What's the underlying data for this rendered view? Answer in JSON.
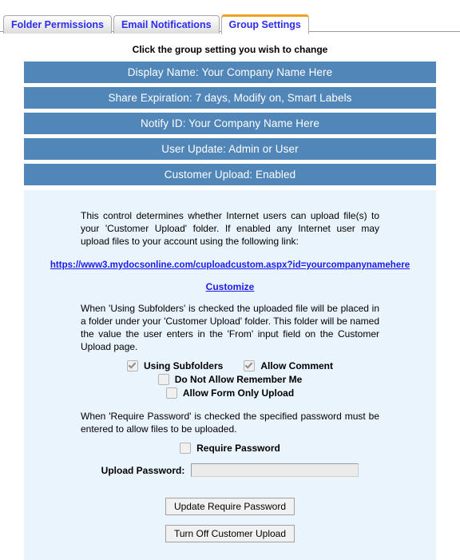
{
  "tabs": [
    {
      "label": "Folder Permissions",
      "active": false
    },
    {
      "label": "Email Notifications",
      "active": false
    },
    {
      "label": "Group Settings",
      "active": true
    }
  ],
  "instruction": "Click the group setting you wish to change",
  "setting_bars": [
    "Display Name:  Your Company Name Here",
    "Share Expiration: 7 days, Modify on, Smart Labels",
    "Notify ID:  Your Company Name Here",
    "User Update:  Admin or User",
    "Customer Upload:  Enabled"
  ],
  "panel": {
    "paragraph_1": "This control determines whether Internet users can upload file(s) to your 'Customer Upload' folder. If enabled any Internet user may upload files to your account using the following link:",
    "upload_link": "https://www3.mydocsonline.com/cuploadcustom.aspx?id=yourcompanynamehere",
    "customize_link": "Customize",
    "paragraph_2": "When 'Using Subfolders' is checked the uploaded file will be placed in a folder under your 'Customer Upload' folder. This folder will be named the value the user enters in the 'From' input field on the Customer Upload page.",
    "checkboxes": [
      {
        "label": "Using Subfolders",
        "checked": true
      },
      {
        "label": "Allow Comment",
        "checked": true
      },
      {
        "label": "Do Not Allow Remember Me",
        "checked": false
      },
      {
        "label": "Allow Form Only Upload",
        "checked": false
      }
    ],
    "paragraph_3": "When 'Require Password' is checked the specified password must be entered to allow files to be uploaded.",
    "require_password": {
      "label": "Require Password",
      "checked": false
    },
    "password_field": {
      "label": "Upload Password:",
      "value": "",
      "placeholder": ""
    },
    "buttons": [
      "Update Require Password",
      "Turn Off Customer Upload"
    ]
  },
  "colors": {
    "bar_blue": "#5186b8",
    "panel_bg": "#eaf4fc",
    "link_blue": "#1a1aee",
    "tab_text": "#2d2df0",
    "active_tab_accent": "#f0a020"
  }
}
